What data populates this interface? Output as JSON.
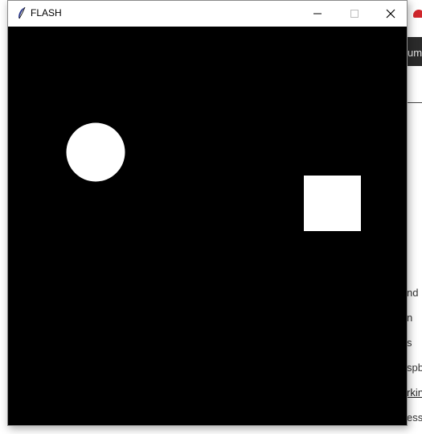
{
  "window": {
    "title": "FLASH",
    "controls": {
      "minimize_icon": "minimize-icon",
      "maximize_icon": "maximize-icon",
      "close_icon": "close-icon"
    }
  },
  "canvas": {
    "background": "#000000",
    "shapes": [
      {
        "kind": "circle",
        "fill": "#ffffff"
      },
      {
        "kind": "square",
        "fill": "#ffffff"
      }
    ]
  },
  "background_app": {
    "topbar_text": "um",
    "lines": [
      "nd I",
      "n",
      "s",
      "spb",
      "rkin",
      "ess"
    ],
    "accent": "#d0262b"
  }
}
